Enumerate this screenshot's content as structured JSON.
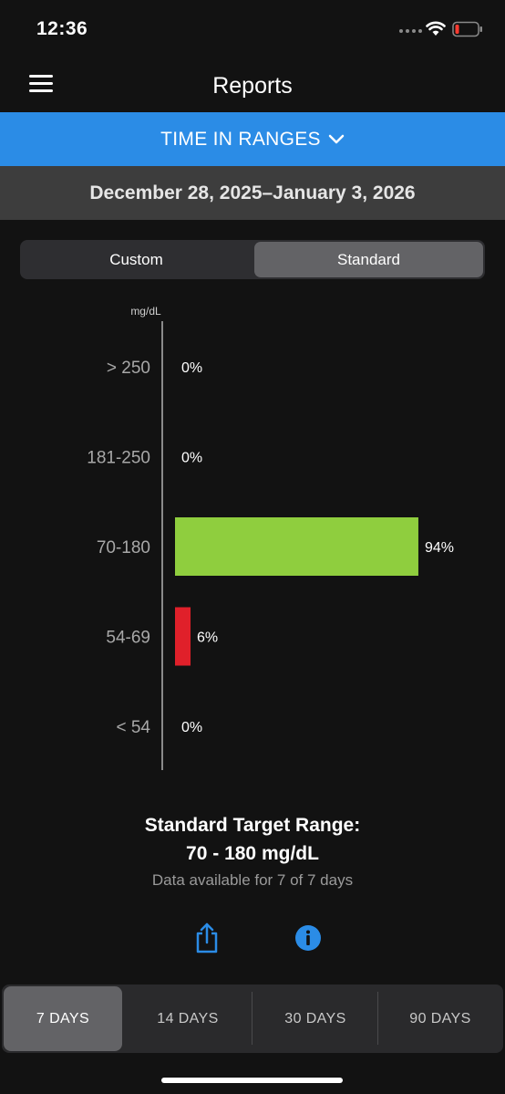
{
  "status_bar": {
    "time": "12:36"
  },
  "nav": {
    "title": "Reports"
  },
  "report_selector": {
    "label": "TIME IN RANGES"
  },
  "date_range": "December 28, 2025–January 3, 2026",
  "segmented": {
    "options": [
      "Custom",
      "Standard"
    ],
    "selected": "Standard"
  },
  "chart_data": {
    "type": "bar",
    "orientation": "horizontal",
    "unit_label": "mg/dL",
    "categories": [
      "> 250",
      "181-250",
      "70-180",
      "54-69",
      "< 54"
    ],
    "values": [
      0,
      0,
      94,
      6,
      0
    ],
    "value_labels": [
      "0%",
      "0%",
      "94%",
      "6%",
      "0%"
    ],
    "colors": [
      "#8a8a8a",
      "#8a8a8a",
      "#8fce3e",
      "#e0202a",
      "#8a8a8a"
    ],
    "xlim": [
      0,
      100
    ]
  },
  "target": {
    "title": "Standard Target Range:",
    "value": "70 - 180 mg/dL",
    "availability": "Data available for 7 of 7 days"
  },
  "day_tabs": {
    "items": [
      "7 DAYS",
      "14 DAYS",
      "30 DAYS",
      "90 DAYS"
    ],
    "selected": "7 DAYS"
  },
  "colors": {
    "accent": "#2b8ce6",
    "background": "#121212"
  }
}
